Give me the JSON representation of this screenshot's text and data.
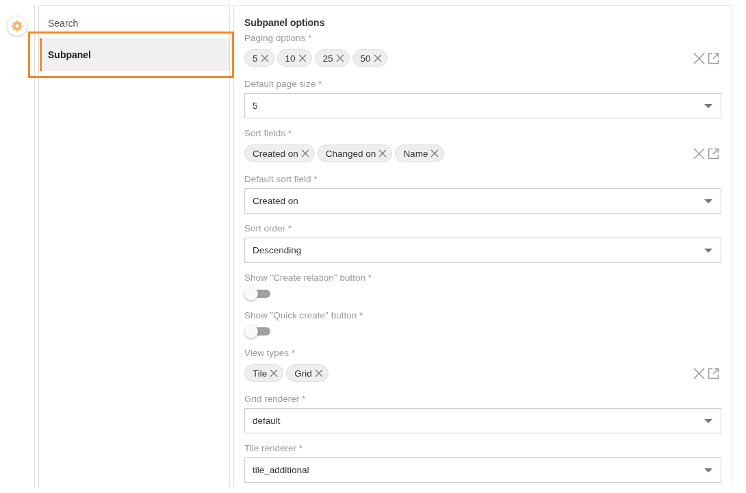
{
  "nav": {
    "items": [
      {
        "label": "Search",
        "selected": false,
        "highlighted": false
      },
      {
        "label": "Subpanel",
        "selected": true,
        "highlighted": true
      }
    ]
  },
  "panel": {
    "title": "Subpanel options",
    "fields": [
      {
        "kind": "tags",
        "label": "Paging options *",
        "tags": [
          "5",
          "10",
          "25",
          "50"
        ]
      },
      {
        "kind": "select",
        "label": "Default page size *",
        "value": "5"
      },
      {
        "kind": "tags",
        "label": "Sort fields *",
        "tags": [
          "Created on",
          "Changed on",
          "Name"
        ]
      },
      {
        "kind": "select",
        "label": "Default sort field *",
        "value": "Created on"
      },
      {
        "kind": "select",
        "label": "Sort order *",
        "value": "Descending"
      },
      {
        "kind": "toggle",
        "label": "Show \"Create relation\" button *",
        "on": false
      },
      {
        "kind": "toggle",
        "label": "Show \"Quick create\" button *",
        "on": false
      },
      {
        "kind": "tags",
        "label": "View types *",
        "tags": [
          "Tile",
          "Grid"
        ]
      },
      {
        "kind": "select",
        "label": "Grid renderer *",
        "value": "default"
      },
      {
        "kind": "select",
        "label": "Tile renderer *",
        "value": "tile_additional"
      }
    ]
  }
}
